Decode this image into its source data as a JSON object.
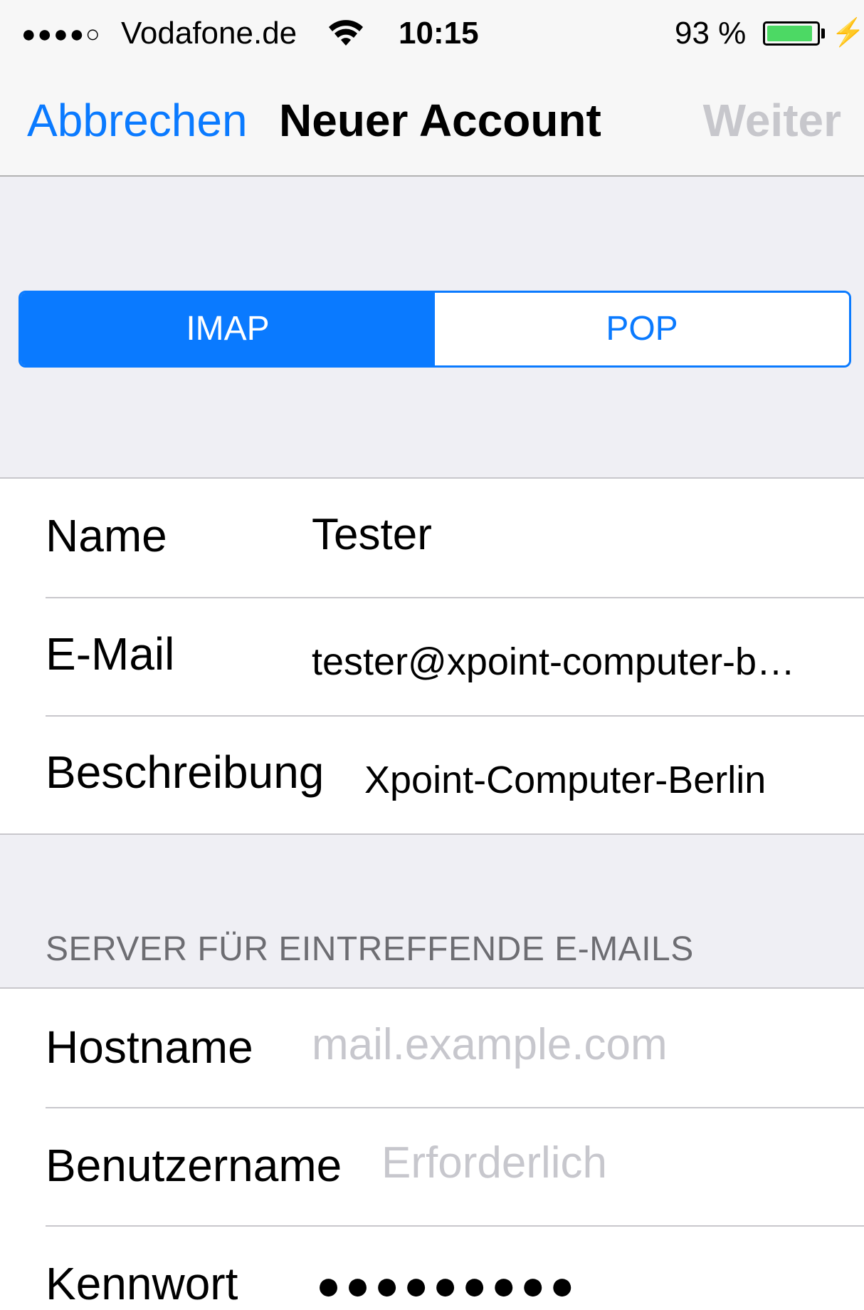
{
  "status_bar": {
    "signal": "●●●●○",
    "carrier": "Vodafone.de",
    "time": "10:15",
    "battery_percent": "93 %",
    "battery_level": 0.93,
    "battery_color": "#4cd964",
    "wifi_icon": "wifi-icon",
    "charging_icon": "bolt-icon"
  },
  "nav_bar": {
    "cancel_label": "Abbrechen",
    "title": "Neuer Account",
    "next_label": "Weiter"
  },
  "account_type": {
    "options": [
      "IMAP",
      "POP"
    ],
    "selected": "IMAP"
  },
  "account_info": {
    "name_label": "Name",
    "name_value": "Tester",
    "email_label": "E-Mail",
    "email_value": "tester@xpoint-computer-b…",
    "description_label": "Beschreibung",
    "description_value": "Xpoint-Computer-Berlin"
  },
  "incoming_server": {
    "header": "SERVER FÜR EINTREFFENDE E-MAILS",
    "hostname_label": "Hostname",
    "hostname_placeholder": "mail.example.com",
    "username_label": "Benutzername",
    "username_placeholder": "Erforderlich",
    "password_label": "Kennwort",
    "password_value": "●●●●●●●●●"
  },
  "colors": {
    "accent": "#0a7aff",
    "disabled": "#c7c7cc",
    "background": "#efeff4"
  }
}
